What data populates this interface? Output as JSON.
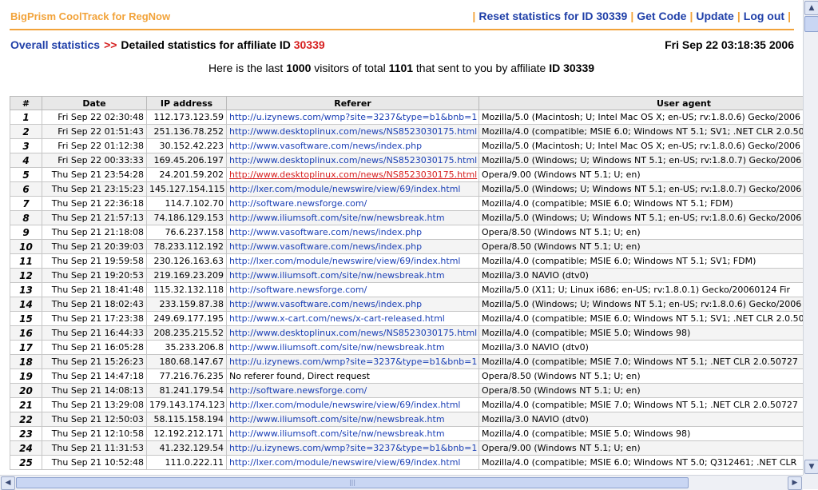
{
  "header": {
    "brand": "BigPrism CoolTrack for RegNow",
    "nav": [
      {
        "label": "Reset statistics for ID 30339"
      },
      {
        "label": "Get Code"
      },
      {
        "label": "Update"
      },
      {
        "label": "Log out"
      }
    ],
    "separator": "|"
  },
  "breadcrumb": {
    "overall": "Overall statistics",
    "arrow": ">>",
    "detail_prefix": "Detailed statistics for affiliate ID",
    "affiliate_id": "30339"
  },
  "datetime": "Fri Sep 22 03:18:35 2006",
  "summary": {
    "p1": "Here is the last",
    "last": "1000",
    "p2": "visitors of total",
    "total": "1101",
    "p3": "that sent to you by affiliate",
    "id_label": "ID 30339"
  },
  "table": {
    "columns": [
      "#",
      "Date",
      "IP address",
      "Referer",
      "User agent"
    ],
    "rows": [
      {
        "n": "1",
        "date": "Fri Sep 22 02:30:48",
        "ip": "112.173.123.59",
        "ref": "http://u.izynews.com/wmp?site=3237&type=b1&bnb=1",
        "ua": "Mozilla/5.0 (Macintosh; U; Intel Mac OS X; en-US; rv:1.8.0.6) Gecko/2006"
      },
      {
        "n": "2",
        "date": "Fri Sep 22 01:51:43",
        "ip": "251.136.78.252",
        "ref": "http://www.desktoplinux.com/news/NS8523030175.html",
        "ua": "Mozilla/4.0 (compatible; MSIE 6.0; Windows NT 5.1; SV1; .NET CLR 2.0.50"
      },
      {
        "n": "3",
        "date": "Fri Sep 22 01:12:38",
        "ip": "30.152.42.223",
        "ref": "http://www.vasoftware.com/news/index.php",
        "ua": "Mozilla/5.0 (Macintosh; U; Intel Mac OS X; en-US; rv:1.8.0.6) Gecko/2006"
      },
      {
        "n": "4",
        "date": "Fri Sep 22 00:33:33",
        "ip": "169.45.206.197",
        "ref": "http://www.desktoplinux.com/news/NS8523030175.html",
        "ua": "Mozilla/5.0 (Windows; U; Windows NT 5.1; en-US; rv:1.8.0.7) Gecko/2006"
      },
      {
        "n": "5",
        "date": "Thu Sep 21 23:54:28",
        "ip": "24.201.59.202",
        "ref": "http://www.desktoplinux.com/news/NS8523030175.html",
        "ua": "Opera/9.00 (Windows NT 5.1; U; en)"
      },
      {
        "n": "6",
        "date": "Thu Sep 21 23:15:23",
        "ip": "145.127.154.115",
        "ref": "http://lxer.com/module/newswire/view/69/index.html",
        "ua": "Mozilla/5.0 (Windows; U; Windows NT 5.1; en-US; rv:1.8.0.7) Gecko/2006"
      },
      {
        "n": "7",
        "date": "Thu Sep 21 22:36:18",
        "ip": "114.7.102.70",
        "ref": "http://software.newsforge.com/",
        "ua": "Mozilla/4.0 (compatible; MSIE 6.0; Windows NT 5.1; FDM)"
      },
      {
        "n": "8",
        "date": "Thu Sep 21 21:57:13",
        "ip": "74.186.129.153",
        "ref": "http://www.iliumsoft.com/site/nw/newsbreak.htm",
        "ua": "Mozilla/5.0 (Windows; U; Windows NT 5.1; en-US; rv:1.8.0.6) Gecko/2006"
      },
      {
        "n": "9",
        "date": "Thu Sep 21 21:18:08",
        "ip": "76.6.237.158",
        "ref": "http://www.vasoftware.com/news/index.php",
        "ua": "Opera/8.50 (Windows NT 5.1; U; en)"
      },
      {
        "n": "10",
        "date": "Thu Sep 21 20:39:03",
        "ip": "78.233.112.192",
        "ref": "http://www.vasoftware.com/news/index.php",
        "ua": "Opera/8.50 (Windows NT 5.1; U; en)"
      },
      {
        "n": "11",
        "date": "Thu Sep 21 19:59:58",
        "ip": "230.126.163.63",
        "ref": "http://lxer.com/module/newswire/view/69/index.html",
        "ua": "Mozilla/4.0 (compatible; MSIE 6.0; Windows NT 5.1; SV1; FDM)"
      },
      {
        "n": "12",
        "date": "Thu Sep 21 19:20:53",
        "ip": "219.169.23.209",
        "ref": "http://www.iliumsoft.com/site/nw/newsbreak.htm",
        "ua": "Mozilla/3.0 NAVIO (dtv0)"
      },
      {
        "n": "13",
        "date": "Thu Sep 21 18:41:48",
        "ip": "115.32.132.118",
        "ref": "http://software.newsforge.com/",
        "ua": "Mozilla/5.0 (X11; U; Linux i686; en-US; rv:1.8.0.1) Gecko/20060124 Fir"
      },
      {
        "n": "14",
        "date": "Thu Sep 21 18:02:43",
        "ip": "233.159.87.38",
        "ref": "http://www.vasoftware.com/news/index.php",
        "ua": "Mozilla/5.0 (Windows; U; Windows NT 5.1; en-US; rv:1.8.0.6) Gecko/2006"
      },
      {
        "n": "15",
        "date": "Thu Sep 21 17:23:38",
        "ip": "249.69.177.195",
        "ref": "http://www.x-cart.com/news/x-cart-released.html",
        "ua": "Mozilla/4.0 (compatible; MSIE 6.0; Windows NT 5.1; SV1; .NET CLR 2.0.50"
      },
      {
        "n": "16",
        "date": "Thu Sep 21 16:44:33",
        "ip": "208.235.215.52",
        "ref": "http://www.desktoplinux.com/news/NS8523030175.html",
        "ua": "Mozilla/4.0 (compatible; MSIE 5.0; Windows 98)"
      },
      {
        "n": "17",
        "date": "Thu Sep 21 16:05:28",
        "ip": "35.233.206.8",
        "ref": "http://www.iliumsoft.com/site/nw/newsbreak.htm",
        "ua": "Mozilla/3.0 NAVIO (dtv0)"
      },
      {
        "n": "18",
        "date": "Thu Sep 21 15:26:23",
        "ip": "180.68.147.67",
        "ref": "http://u.izynews.com/wmp?site=3237&type=b1&bnb=1",
        "ua": "Mozilla/4.0 (compatible; MSIE 7.0; Windows NT 5.1; .NET CLR 2.0.50727"
      },
      {
        "n": "19",
        "date": "Thu Sep 21 14:47:18",
        "ip": "77.216.76.235",
        "ref": "No referer found, Direct request",
        "ua": "Opera/8.50 (Windows NT 5.1; U; en)"
      },
      {
        "n": "20",
        "date": "Thu Sep 21 14:08:13",
        "ip": "81.241.179.54",
        "ref": "http://software.newsforge.com/",
        "ua": "Opera/8.50 (Windows NT 5.1; U; en)"
      },
      {
        "n": "21",
        "date": "Thu Sep 21 13:29:08",
        "ip": "179.143.174.123",
        "ref": "http://lxer.com/module/newswire/view/69/index.html",
        "ua": "Mozilla/4.0 (compatible; MSIE 7.0; Windows NT 5.1; .NET CLR 2.0.50727"
      },
      {
        "n": "22",
        "date": "Thu Sep 21 12:50:03",
        "ip": "58.115.158.194",
        "ref": "http://www.iliumsoft.com/site/nw/newsbreak.htm",
        "ua": "Mozilla/3.0 NAVIO (dtv0)"
      },
      {
        "n": "23",
        "date": "Thu Sep 21 12:10:58",
        "ip": "12.192.212.171",
        "ref": "http://www.iliumsoft.com/site/nw/newsbreak.htm",
        "ua": "Mozilla/4.0 (compatible; MSIE 5.0; Windows 98)"
      },
      {
        "n": "24",
        "date": "Thu Sep 21 11:31:53",
        "ip": "41.232.129.54",
        "ref": "http://u.izynews.com/wmp?site=3237&type=b1&bnb=1",
        "ua": "Opera/9.00 (Windows NT 5.1; U; en)"
      },
      {
        "n": "25",
        "date": "Thu Sep 21 10:52:48",
        "ip": "111.0.222.11",
        "ref": "http://lxer.com/module/newswire/view/69/index.html",
        "ua": "Mozilla/4.0 (compatible; MSIE 6.0; Windows NT 5.0; Q312461; .NET CLR"
      }
    ]
  },
  "scrollbars": {
    "up_icon": "scroll-up-arrow",
    "down_icon": "scroll-down-arrow",
    "left_icon": "scroll-left-arrow",
    "right_icon": "scroll-right-arrow"
  },
  "colors": {
    "brand": "#f2a33a",
    "link": "#1f3fa8",
    "accent_red": "#d62020"
  }
}
